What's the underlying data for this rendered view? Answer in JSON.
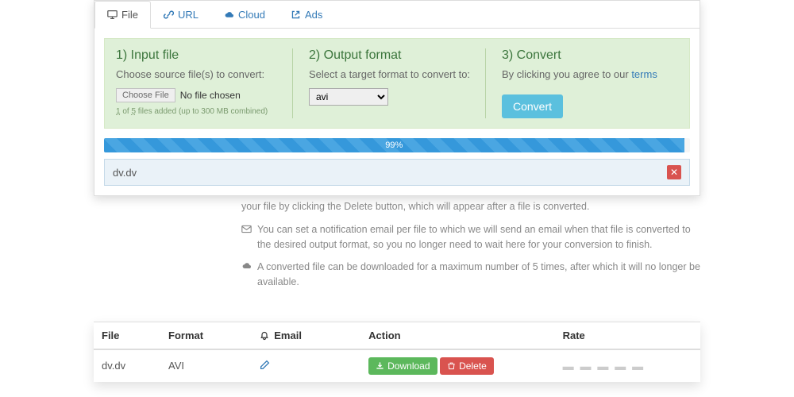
{
  "tabs": {
    "file": "File",
    "url": "URL",
    "cloud": "Cloud",
    "ads": "Ads"
  },
  "step1": {
    "title": "1) Input file",
    "desc": "Choose source file(s) to convert:",
    "choose": "Choose File",
    "nofile": "No file chosen",
    "info_a": "1",
    "info_b": " of ",
    "info_c": "5",
    "info_d": " files added (up to 300 MB combined)"
  },
  "step2": {
    "title": "2) Output format",
    "desc": "Select a target format to convert to:",
    "selected": "avi"
  },
  "step3": {
    "title": "3) Convert",
    "terms_pre": "By clicking you agree to our ",
    "terms_link": "terms",
    "button": "Convert"
  },
  "progress": {
    "percent": 99,
    "label": "99%"
  },
  "filebox": {
    "name": "dv.dv"
  },
  "info": {
    "line0_tail": "your file by clicking the Delete button, which will appear after a file is converted.",
    "line1": "You can set a notification email per file to which we will send an email when that file is converted to the desired output format, so you no longer need to wait here for your conversion to finish.",
    "line2": "A converted file can be downloaded for a maximum number of 5 times, after which it will no longer be available."
  },
  "table": {
    "h_file": "File",
    "h_format": "Format",
    "h_email": "Email",
    "h_action": "Action",
    "h_rate": "Rate",
    "r_file": "dv.dv",
    "r_format": "AVI",
    "download": "Download",
    "delete": "Delete"
  }
}
